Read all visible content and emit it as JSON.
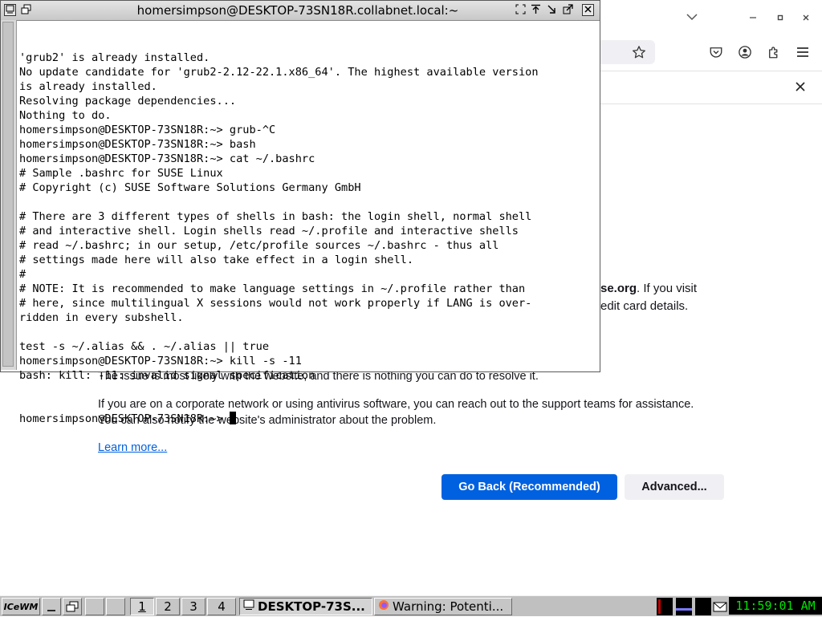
{
  "browser": {
    "error": {
      "partial_bold": "se.org",
      "partial_line1_rest": ". If you visit",
      "partial_line2": "edit card details.",
      "issue_line": "The issue is most likely with the website, and there is nothing you can do to resolve it.",
      "corporate_line1": "If you are on a corporate network or using antivirus software, you can reach out to the support teams for assistance.",
      "corporate_line2": "You can also notify the website's administrator about the problem.",
      "learn_more": "Learn more...",
      "go_back_label": "Go Back (Recommended)",
      "advanced_label": "Advanced..."
    }
  },
  "terminal": {
    "title": "homersimpson@DESKTOP-73SN18R.collabnet.local:~",
    "lines": [
      "'grub2' is already installed.",
      "No update candidate for 'grub2-2.12-22.1.x86_64'. The highest available version",
      "is already installed.",
      "Resolving package dependencies...",
      "Nothing to do.",
      "homersimpson@DESKTOP-73SN18R:~> grub-^C",
      "homersimpson@DESKTOP-73SN18R:~> bash",
      "homersimpson@DESKTOP-73SN18R:~> cat ~/.bashrc",
      "# Sample .bashrc for SUSE Linux",
      "# Copyright (c) SUSE Software Solutions Germany GmbH",
      "",
      "# There are 3 different types of shells in bash: the login shell, normal shell",
      "# and interactive shell. Login shells read ~/.profile and interactive shells",
      "# read ~/.bashrc; in our setup, /etc/profile sources ~/.bashrc - thus all",
      "# settings made here will also take effect in a login shell.",
      "#",
      "# NOTE: It is recommended to make language settings in ~/.profile rather than",
      "# here, since multilingual X sessions would not work properly if LANG is over-",
      "ridden in every subshell.",
      "",
      "test -s ~/.alias && . ~/.alias || true",
      "homersimpson@DESKTOP-73SN18R:~> kill -s -11",
      "bash: kill: -11: invalid signal specification"
    ],
    "prompt": "homersimpson@DESKTOP-73SN18R:~> "
  },
  "taskbar": {
    "start_label": "ICeWM",
    "workspaces": [
      "1",
      "2",
      "3",
      "4"
    ],
    "active_workspace": "1",
    "tasks": [
      {
        "label": "DESKTOP-73S..."
      },
      {
        "label": "Warning: Potenti..."
      }
    ],
    "clock": "11:59:01 AM"
  },
  "colors": {
    "primary_button": "#0061e0",
    "link": "#0060df",
    "clock_text": "#00e400"
  }
}
